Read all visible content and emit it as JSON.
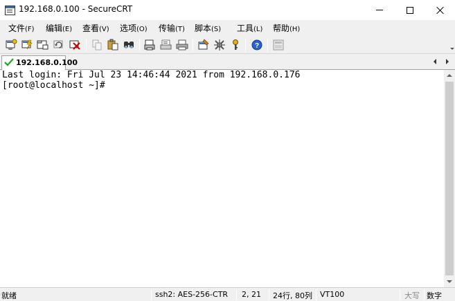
{
  "window": {
    "title": "192.168.0.100 - SecureCRT"
  },
  "menu": [
    {
      "label": "文件",
      "acc": "(F)"
    },
    {
      "label": "编辑",
      "acc": "(E)"
    },
    {
      "label": "查看",
      "acc": "(V)"
    },
    {
      "label": "选项",
      "acc": "(O)"
    },
    {
      "label": "传输",
      "acc": "(T)"
    },
    {
      "label": "脚本",
      "acc": "(S)"
    },
    {
      "label": "工具",
      "acc": "(L)"
    },
    {
      "label": "帮助",
      "acc": "(H)"
    }
  ],
  "toolbar": {
    "icons": [
      "connect-icon",
      "quick-connect-icon",
      "connect-in-tab-icon",
      "reconnect-icon",
      "disconnect-icon",
      "copy-icon",
      "paste-icon",
      "find-icon",
      "print-screen-icon",
      "print-selection-icon",
      "print-icon",
      "session-options-icon",
      "global-options-icon",
      "keymap-icon",
      "help-icon",
      "sftp-icon"
    ]
  },
  "tabs": [
    {
      "label": "192.168.0.100",
      "status": "connected"
    }
  ],
  "terminal": {
    "lines": [
      "Last login: Fri Jul 23 14:46:44 2021 from 192.168.0.176",
      "[root@localhost ~]#"
    ]
  },
  "status": {
    "ready": "就绪",
    "protocol": "ssh2: AES-256-CTR",
    "cursor_pos": "2,  21",
    "size": "24行, 80列",
    "emulation": "VT100",
    "caps": "大写",
    "num": "数字"
  },
  "colors": {
    "chrome": "#f0f0f0",
    "terminal_bg": "#ffffff",
    "connected_check": "#2fa52f"
  }
}
